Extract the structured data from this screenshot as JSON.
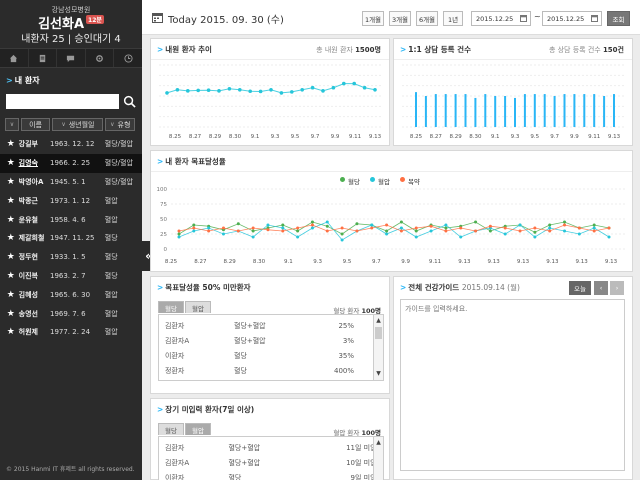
{
  "sidebar": {
    "hospital": "강남성모병원",
    "user_name": "김선화A",
    "badge": "12분",
    "stats": "내환자 25 | 승인대기 4",
    "patient_section_title": "내 환자",
    "search_placeholder": "",
    "columns": [
      "이름",
      "생년월일",
      "유형"
    ],
    "patients": [
      {
        "name": "강길부",
        "birth": "1963. 12. 12",
        "type": "혈당/혈압",
        "selected": false
      },
      {
        "name": "김영숙",
        "birth": "1966. 2. 25",
        "type": "혈당/혈압",
        "selected": true
      },
      {
        "name": "박영아A",
        "birth": "1945. 5. 1",
        "type": "혈당/혈압",
        "selected": false
      },
      {
        "name": "박종근",
        "birth": "1973. 1. 12",
        "type": "혈압",
        "selected": false
      },
      {
        "name": "윤유철",
        "birth": "1958. 4. 6",
        "type": "혈압",
        "selected": false
      },
      {
        "name": "제갈희철",
        "birth": "1947. 11. 25",
        "type": "혈당",
        "selected": false
      },
      {
        "name": "정두현",
        "birth": "1933. 1. 5",
        "type": "혈당",
        "selected": false
      },
      {
        "name": "이진복",
        "birth": "1963. 2. 7",
        "type": "혈당",
        "selected": false
      },
      {
        "name": "김혜성",
        "birth": "1965. 6. 30",
        "type": "혈압",
        "selected": false
      },
      {
        "name": "송영선",
        "birth": "1969. 7. 6",
        "type": "혈압",
        "selected": false
      },
      {
        "name": "허원제",
        "birth": "1977. 2. 24",
        "type": "혈압",
        "selected": false
      }
    ],
    "copyright": "© 2015 Hanmi IT 휴제트 all rights reserved."
  },
  "topbar": {
    "today_label": "Today 2015. 09. 30 (수)",
    "period_buttons": [
      "1개월",
      "3개월",
      "6개월",
      "1년"
    ],
    "date_from": "2015.12.25",
    "date_to": "2015.12.25",
    "tilde": "~",
    "search_button": "조회"
  },
  "panels": {
    "patient_trend": {
      "title": "내원 환자 추이",
      "sub_label": "총 내원 환자",
      "sub_value": "1500명"
    },
    "consult_count": {
      "title": "1:1 상담 등록 건수",
      "sub_label": "총 상담 등록 건수",
      "sub_value": "150건"
    },
    "goal_rate": {
      "title": "내 환자 목표달성율",
      "legend": [
        "혈당",
        "혈압",
        "복약"
      ]
    },
    "under50": {
      "title": "목표달성율 50% 미만환자",
      "tabs": [
        "혈당",
        "혈압"
      ],
      "count_label": "혈당 환자",
      "count_value": "100명",
      "rows": [
        {
          "name": "김환자",
          "type": "혈당+혈압",
          "value": "25%"
        },
        {
          "name": "김환자A",
          "type": "혈당+혈압",
          "value": "3%"
        },
        {
          "name": "이환자",
          "type": "혈당",
          "value": "35%"
        },
        {
          "name": "정환자",
          "type": "혈당",
          "value": "400%"
        }
      ]
    },
    "long_term": {
      "title": "장기 미입력 환자(7일 이상)",
      "tabs": [
        "혈당",
        "혈압"
      ],
      "count_label": "혈압 환자",
      "count_value": "100명",
      "rows": [
        {
          "name": "김환자",
          "type": "혈당+혈압",
          "value": "11일 미입력"
        },
        {
          "name": "김환자A",
          "type": "혈당+혈압",
          "value": "10일 미입력"
        },
        {
          "name": "이환자",
          "type": "혈당",
          "value": "9일 미입력"
        }
      ]
    },
    "health_guide": {
      "title": "전체 건강가이드",
      "date": "2015.09.14 (월)",
      "today_button": "오늘",
      "placeholder": "가이드를 입력하세요."
    }
  },
  "colors": {
    "accent": "#29b6f6",
    "glucose": "#4caf50",
    "pressure": "#26c6da",
    "medication": "#ff7043",
    "sidebar_bg": "#2b2b2b"
  },
  "chart_data": [
    {
      "type": "line",
      "title": "내원 환자 추이",
      "categories": [
        "8.25",
        "8.27",
        "8.29",
        "8.30",
        "9.1",
        "9.3",
        "9.5",
        "9.7",
        "9.9",
        "9.11",
        "9.13"
      ],
      "series": [
        {
          "values": [
            16.5,
            18,
            17.5,
            17.7,
            17.8,
            17.5,
            18.5,
            18,
            17.3,
            17.2,
            18,
            16.5,
            17,
            18,
            19,
            17.5,
            19,
            21,
            21,
            19,
            18
          ]
        }
      ],
      "x_labels_count": 11,
      "ylim": [
        0,
        30
      ],
      "y_ticks": [],
      "grid": true
    },
    {
      "type": "bar",
      "title": "1:1 상담 등록 건수",
      "categories": [
        "8.25",
        "8.27",
        "8.29",
        "8.30",
        "9.1",
        "9.3",
        "9.5",
        "9.7",
        "9.9",
        "9.11",
        "9.13"
      ],
      "series": [
        {
          "values": [
            9,
            8,
            8.5,
            8.5,
            8.5,
            8.5,
            7.5,
            8.5,
            8,
            8,
            7.5,
            8.5,
            8.5,
            8.5,
            8,
            8.5,
            8.5,
            8.5,
            8.5,
            8,
            8.5
          ]
        }
      ],
      "ylim": [
        0,
        16
      ],
      "grid": true
    },
    {
      "type": "line",
      "title": "내 환자 목표달성율",
      "categories": [
        "8.25",
        "8.27",
        "8.29",
        "8.30",
        "9.1",
        "9.3",
        "9.5",
        "9.7",
        "9.9",
        "9.11",
        "9.13"
      ],
      "x_tick_labels": [
        "8.25",
        "8.27",
        "8.29",
        "8.30",
        "9.1",
        "9.3",
        "9.5",
        "9.7",
        "9.9",
        "9.11",
        "9.13",
        "9.13",
        "9.13",
        "9.13",
        "9.13",
        "9.13"
      ],
      "y_ticks": [
        0,
        25,
        50,
        75,
        100
      ],
      "ylim": [
        0,
        100
      ],
      "series": [
        {
          "name": "혈당",
          "values": [
            25,
            40,
            38,
            32,
            42,
            30,
            35,
            40,
            30,
            45,
            38,
            25,
            42,
            40,
            30,
            45,
            30,
            40,
            35,
            38,
            45,
            30,
            38,
            40,
            28,
            40,
            45,
            35,
            40,
            35
          ]
        },
        {
          "name": "혈압",
          "values": [
            20,
            30,
            35,
            25,
            30,
            20,
            40,
            35,
            20,
            35,
            45,
            15,
            30,
            40,
            25,
            35,
            20,
            30,
            40,
            20,
            30,
            35,
            25,
            40,
            20,
            35,
            30,
            25,
            35,
            20
          ]
        },
        {
          "name": "복약",
          "values": [
            30,
            35,
            30,
            35,
            30,
            35,
            32,
            30,
            35,
            40,
            30,
            35,
            30,
            35,
            40,
            30,
            35,
            38,
            30,
            35,
            30,
            38,
            35,
            30,
            35,
            30,
            40,
            35,
            30,
            35
          ]
        }
      ],
      "grid": true,
      "legend": "top-center"
    }
  ]
}
